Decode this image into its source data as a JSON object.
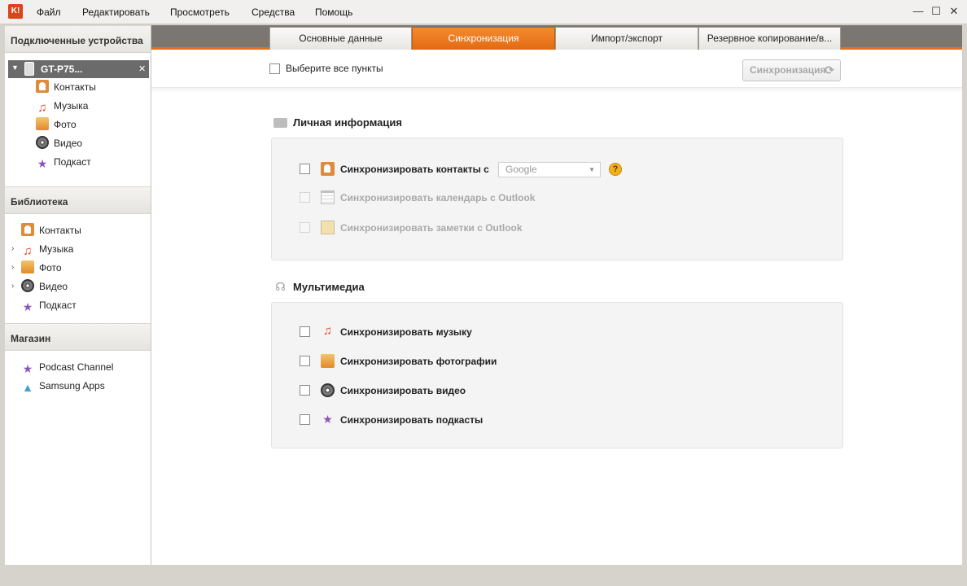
{
  "menu": {
    "logo": "K!",
    "items": [
      "Файл",
      "Редактировать",
      "Просмотреть",
      "Средства",
      "Помощь"
    ]
  },
  "window_controls": {
    "minimize": "—",
    "maximize": "☐",
    "close": "✕"
  },
  "sidebar": {
    "connected_header": "Подключенные устройства",
    "device_name": "GT-P75...",
    "device_items": [
      "Контакты",
      "Музыка",
      "Фото",
      "Видео",
      "Подкаст"
    ],
    "library_header": "Библиотека",
    "library_items": [
      "Контакты",
      "Музыка",
      "Фото",
      "Видео",
      "Подкаст"
    ],
    "store_header": "Магазин",
    "store_items": [
      "Podcast Channel",
      "Samsung Apps"
    ]
  },
  "tabs": [
    "Основные данные",
    "Синхронизация",
    "Импорт/экспорт",
    "Резервное копирование/в..."
  ],
  "toolbar": {
    "select_all_label": "Выберите все пункты",
    "sync_button": "Синхронизация",
    "sync_icon": "⟳"
  },
  "personal": {
    "title": "Личная информация",
    "contacts_label": "Синхронизировать контакты с",
    "contacts_source": "Google",
    "help": "?",
    "calendar_label": "Синхронизировать календарь с Outlook",
    "notes_label": "Синхронизировать заметки с Outlook"
  },
  "multimedia": {
    "title": "Мультимедиа",
    "music_label": "Синхронизировать музыку",
    "photos_label": "Синхронизировать фотографии",
    "video_label": "Синхронизировать видео",
    "podcasts_label": "Синхронизировать подкасты"
  },
  "colors": {
    "accent": "#e8701a",
    "tab_bar": "#7a7672"
  }
}
